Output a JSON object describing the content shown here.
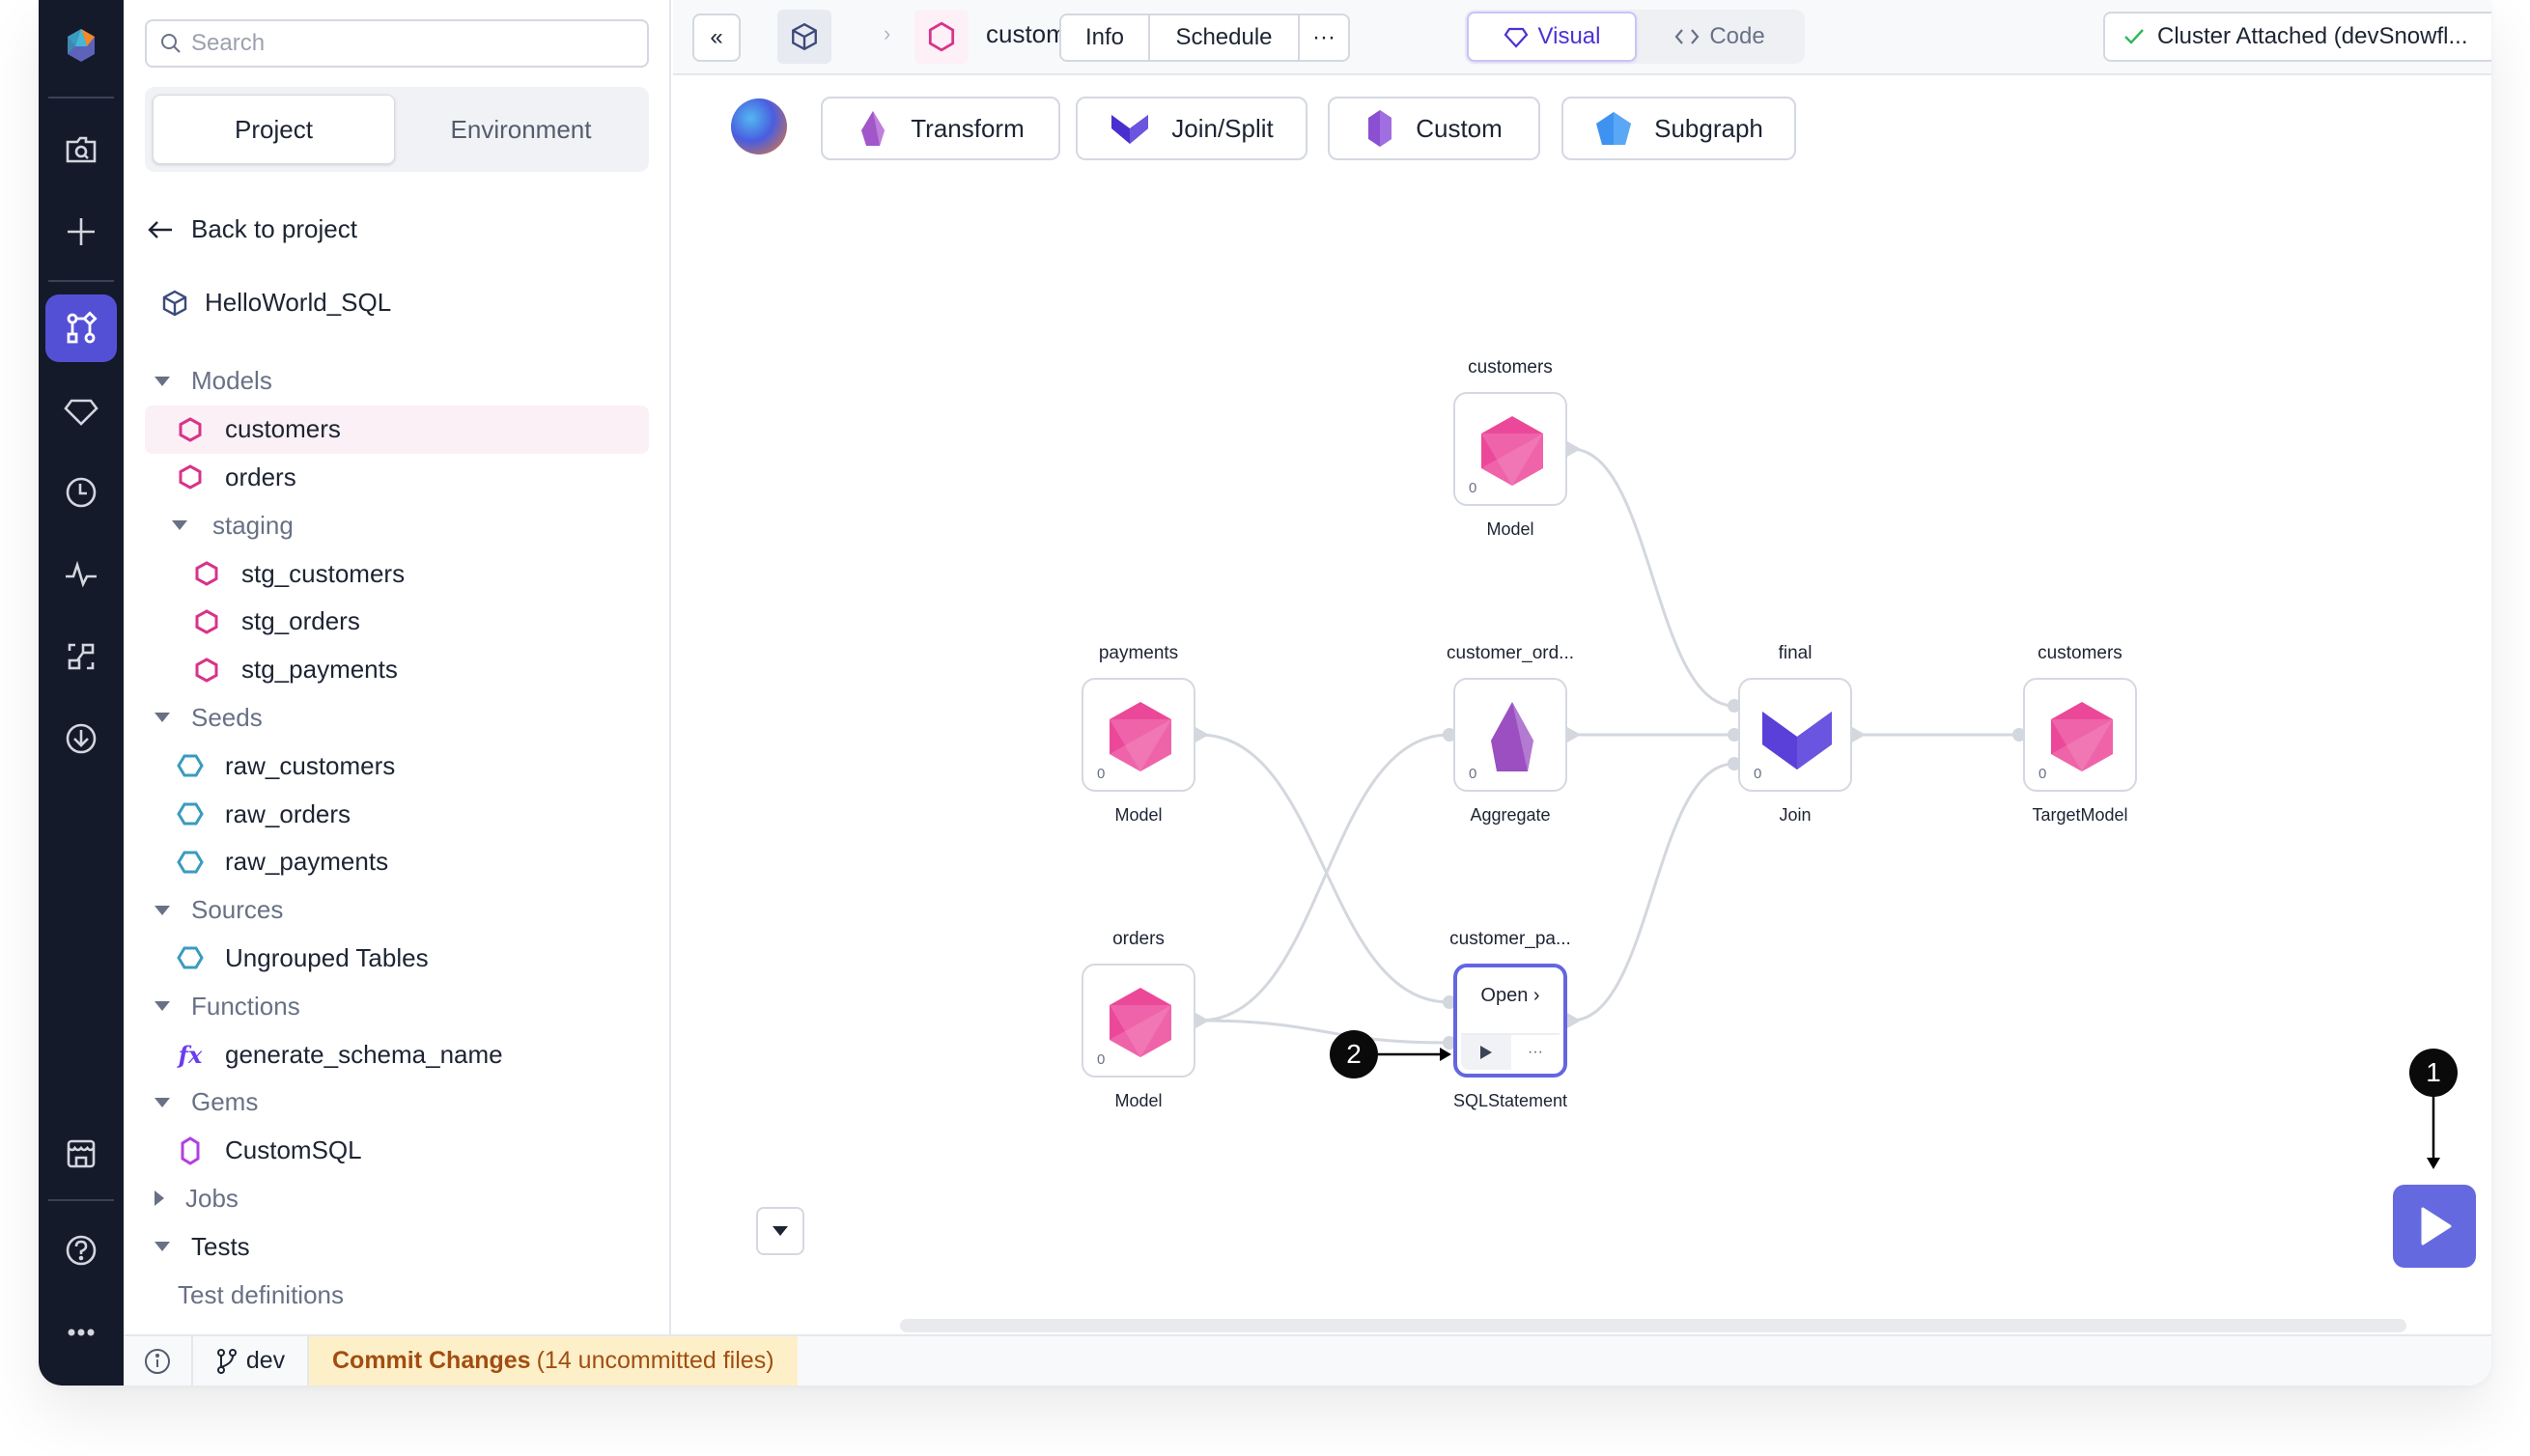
{
  "rail": {
    "items": [
      {
        "name": "logo-icon"
      },
      {
        "name": "search-folder-icon"
      },
      {
        "name": "plus-icon"
      },
      {
        "name": "pipeline-graph-icon",
        "active": true
      },
      {
        "name": "gem-icon"
      },
      {
        "name": "clock-icon"
      },
      {
        "name": "activity-icon"
      },
      {
        "name": "lineage-icon"
      },
      {
        "name": "download-circle-icon"
      },
      {
        "name": "marketplace-icon"
      },
      {
        "name": "help-icon"
      },
      {
        "name": "more-icon"
      }
    ]
  },
  "sidebar": {
    "search_placeholder": "Search",
    "tabs": [
      {
        "label": "Project",
        "active": true
      },
      {
        "label": "Environment",
        "active": false
      }
    ],
    "back_label": "Back to project",
    "project_name": "HelloWorld_SQL",
    "tree": [
      {
        "type": "group",
        "label": "Models",
        "depth": 0,
        "expanded": true
      },
      {
        "type": "model",
        "label": "customers",
        "depth": 1,
        "selected": true
      },
      {
        "type": "model",
        "label": "orders",
        "depth": 1
      },
      {
        "type": "group",
        "label": "staging",
        "depth": 1,
        "expanded": true
      },
      {
        "type": "model",
        "label": "stg_customers",
        "depth": 2
      },
      {
        "type": "model",
        "label": "stg_orders",
        "depth": 2
      },
      {
        "type": "model",
        "label": "stg_payments",
        "depth": 2
      },
      {
        "type": "group",
        "label": "Seeds",
        "depth": 0,
        "expanded": true
      },
      {
        "type": "seed",
        "label": "raw_customers",
        "depth": 1
      },
      {
        "type": "seed",
        "label": "raw_orders",
        "depth": 1
      },
      {
        "type": "seed",
        "label": "raw_payments",
        "depth": 1
      },
      {
        "type": "group",
        "label": "Sources",
        "depth": 0,
        "expanded": true
      },
      {
        "type": "source",
        "label": "Ungrouped Tables",
        "depth": 1
      },
      {
        "type": "group",
        "label": "Functions",
        "depth": 0,
        "expanded": true
      },
      {
        "type": "function",
        "label": "generate_schema_name",
        "depth": 1,
        "icon_text": "fx"
      },
      {
        "type": "group",
        "label": "Gems",
        "depth": 0,
        "expanded": true
      },
      {
        "type": "gem",
        "label": "CustomSQL",
        "depth": 1
      },
      {
        "type": "group",
        "label": "Jobs",
        "depth": 0,
        "expanded": false
      },
      {
        "type": "group",
        "label": "Tests",
        "depth": 0,
        "expanded": true,
        "dark": true
      },
      {
        "type": "leaf-muted",
        "label": "Test definitions",
        "depth": 1
      }
    ]
  },
  "header": {
    "collapse_label": "«",
    "breadcrumb_sep": "›",
    "model_title": "customers",
    "tabs": [
      "Info",
      "Schedule",
      "···"
    ],
    "view_toggle": [
      {
        "label": "Visual",
        "active": true
      },
      {
        "label": "Code",
        "active": false
      }
    ],
    "cluster_label": "Cluster Attached (devSnowfl...",
    "cluster_status_color": "#2fb85c"
  },
  "gem_toolbar": [
    {
      "label": "Transform",
      "icon": "transform-gem-icon",
      "color": "#a157c9"
    },
    {
      "label": "Join/Split",
      "icon": "join-gem-icon",
      "color": "#4a2fcf"
    },
    {
      "label": "Custom",
      "icon": "custom-gem-icon",
      "color": "#8b4fd1"
    },
    {
      "label": "Subgraph",
      "icon": "subgraph-gem-icon",
      "color": "#3f93f0"
    }
  ],
  "graph": {
    "nodes": [
      {
        "id": "customers_src",
        "title": "customers",
        "type": "Model",
        "count": "0",
        "kind": "model"
      },
      {
        "id": "payments",
        "title": "payments",
        "type": "Model",
        "count": "0",
        "kind": "model"
      },
      {
        "id": "customer_orders",
        "title": "customer_ord...",
        "type": "Aggregate",
        "count": "0",
        "kind": "aggregate"
      },
      {
        "id": "final",
        "title": "final",
        "type": "Join",
        "count": "0",
        "kind": "join"
      },
      {
        "id": "customers_target",
        "title": "customers",
        "type": "TargetModel",
        "count": "0",
        "kind": "model"
      },
      {
        "id": "orders",
        "title": "orders",
        "type": "Model",
        "count": "0",
        "kind": "model"
      },
      {
        "id": "customer_payments",
        "title": "customer_pa...",
        "type": "SQLStatement",
        "kind": "sql",
        "selected": true,
        "open_label": "Open ›",
        "more_label": "···"
      }
    ],
    "edges": [
      [
        "customers_src",
        "final"
      ],
      [
        "payments",
        "customer_payments"
      ],
      [
        "orders",
        "customer_orders"
      ],
      [
        "orders",
        "customer_payments"
      ],
      [
        "customer_orders",
        "final"
      ],
      [
        "customer_payments",
        "final"
      ],
      [
        "final",
        "customers_target"
      ]
    ]
  },
  "callouts": [
    {
      "label": "1",
      "target": "run-pipeline-button"
    },
    {
      "label": "2",
      "target": "node-run-button"
    }
  ],
  "statusbar": {
    "branch": "dev",
    "commit_label": "Commit Changes",
    "commit_detail": "(14 uncommitted files)"
  },
  "colors": {
    "accent": "#5450d6",
    "run_button": "#6469e0",
    "model_pink": "#ec4899",
    "seed_teal": "#3a9bbf",
    "rail_bg": "#141a29",
    "commit_bg": "#fdf0c9",
    "commit_text": "#a34d11"
  }
}
